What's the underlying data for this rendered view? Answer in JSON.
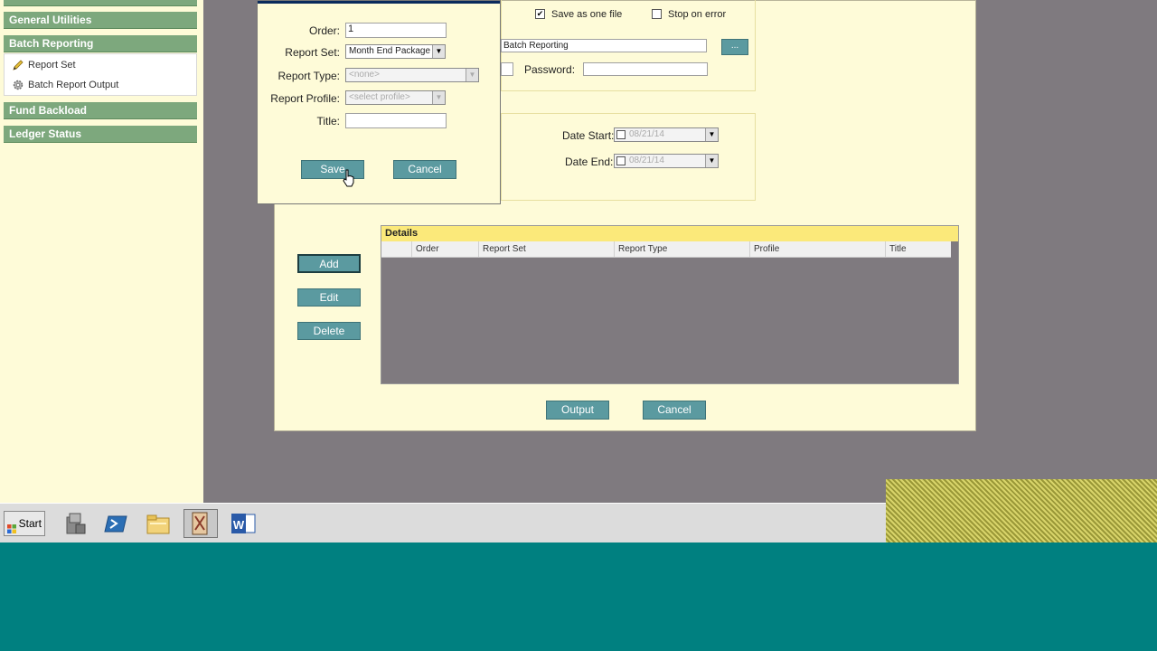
{
  "sidebar": {
    "headers": [
      "General Utilities",
      "Batch Reporting",
      "Fund Backload",
      "Ledger Status"
    ],
    "items": [
      "Report Set",
      "Batch Report Output"
    ]
  },
  "main": {
    "save_as_one_file": "Save as one file",
    "stop_on_error": "Stop on error",
    "path_value": "Batch Reporting",
    "browse_label": "...",
    "password_label": "Password:",
    "date_start_label": "Date Start:",
    "date_start_value": "08/21/14",
    "date_end_label": "Date End:",
    "date_end_value": "08/21/14",
    "add": "Add",
    "edit": "Edit",
    "delete": "Delete",
    "output": "Output",
    "cancel": "Cancel",
    "details": {
      "title": "Details",
      "columns": [
        "Order",
        "Report Set",
        "Report Type",
        "Profile",
        "Title"
      ]
    }
  },
  "dialog": {
    "order_label": "Order:",
    "order_value": "1",
    "report_set_label": "Report Set:",
    "report_set_value": "Month End Package",
    "report_type_label": "Report Type:",
    "report_type_value": "<none>",
    "report_profile_label": "Report Profile:",
    "report_profile_value": "<select profile>",
    "title_label": "Title:",
    "title_value": "",
    "save": "Save",
    "cancel": "Cancel"
  },
  "taskbar": {
    "start": "Start",
    "icons": [
      "server-manager-icon",
      "powershell-icon",
      "explorer-folder-icon",
      "app-icon",
      "word-icon"
    ]
  },
  "colors": {
    "desktop": "#008080",
    "workspace": "#7f7a7f",
    "panel": "#fefbd8",
    "nav_header": "#7da87d",
    "button": "#5b9aa0",
    "details_header": "#fbe97a"
  }
}
